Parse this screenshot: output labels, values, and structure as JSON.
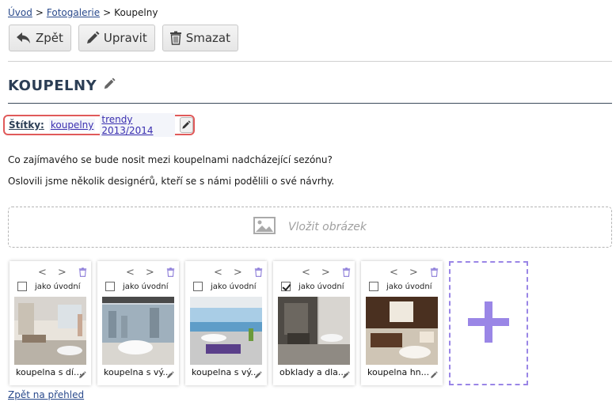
{
  "breadcrumb": {
    "home": "Úvod",
    "gallery": "Fotogalerie",
    "current": "Koupelny",
    "sep": ">"
  },
  "toolbar": {
    "back_label": "Zpět",
    "edit_label": "Upravit",
    "delete_label": "Smazat"
  },
  "page_title": "KOUPELNY",
  "tags": {
    "label": "Štítky:",
    "items": [
      "koupelny",
      "trendy 2013/2014"
    ]
  },
  "description": [
    "Co zajímavého se bude nosit mezi koupelnami nadcházející sezónu?",
    "Oslovili jsme několik designérů, kteří se s námi podělili o své návrhy."
  ],
  "insert_image_label": "Vložit obrázek",
  "nav_prev": "<",
  "nav_next": ">",
  "photos": [
    {
      "cover_label": "jako úvodní",
      "checked": false,
      "caption": "koupelna s dí..."
    },
    {
      "cover_label": "jako úvodní",
      "checked": false,
      "caption": "koupelna s vý..."
    },
    {
      "cover_label": "jako úvodní",
      "checked": false,
      "caption": "koupelna s vý..."
    },
    {
      "cover_label": "jako úvodní",
      "checked": true,
      "caption": "obklady a dla..."
    },
    {
      "cover_label": "jako úvodní",
      "checked": false,
      "caption": "koupelna hn..."
    }
  ],
  "back_to_overview": "Zpět na přehled",
  "colors": {
    "accent": "#9a86e6",
    "tag_border": "#e05a5a",
    "title": "#2c3e55"
  }
}
